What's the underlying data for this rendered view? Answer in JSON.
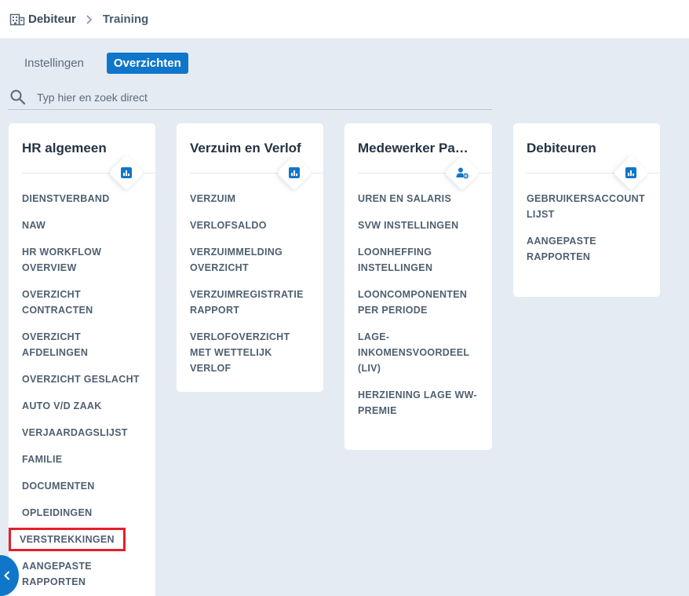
{
  "breadcrumb": {
    "icon": "building-icon",
    "items": [
      "Debiteur",
      "Training"
    ]
  },
  "tabs": [
    {
      "label": "Instellingen",
      "active": false
    },
    {
      "label": "Overzichten",
      "active": true
    }
  ],
  "search": {
    "placeholder": "Typ hier en zoek direct",
    "value": ""
  },
  "colors": {
    "accent": "#1076c9",
    "background": "#e5ebf3",
    "highlight": "#e3202a"
  },
  "cards": [
    {
      "title": "HR algemeen",
      "icon": "bar-chart-icon",
      "links": [
        "DIENSTVERBAND",
        "NAW",
        "HR WORKFLOW OVERVIEW",
        "OVERZICHT CONTRACTEN",
        "OVERZICHT AFDELINGEN",
        "OVERZICHT GESLACHT",
        "AUTO V/D ZAAK",
        "VERJAARDAGSLIJST",
        "FAMILIE",
        "DOCUMENTEN",
        "OPLEIDINGEN",
        "VERSTREKKINGEN",
        "AANGEPASTE RAPPORTEN"
      ],
      "highlighted_link": "VERSTREKKINGEN"
    },
    {
      "title": "Verzuim en Verlof",
      "icon": "bar-chart-icon",
      "links": [
        "VERZUIM",
        "VERLOFSALDO",
        "VERZUIMMELDING OVERZICHT",
        "VERZUIMREGISTRATIE RAPPORT",
        "VERLOFOVERZICHT MET WETTELIJK VERLOF"
      ]
    },
    {
      "title": "Medewerker Pa…",
      "icon": "user-settings-icon",
      "links": [
        "UREN EN SALARIS",
        "SVW INSTELLINGEN",
        "LOONHEFFING INSTELLINGEN",
        "LOONCOMPONENTEN PER PERIODE",
        "LAGE-INKOMENSVOORDEEL (LIV)",
        "HERZIENING LAGE WW-PREMIE"
      ]
    },
    {
      "title": "Debiteuren",
      "icon": "bar-chart-icon",
      "links": [
        "GEBRUIKERSACCOUNT LIJST",
        "AANGEPASTE RAPPORTEN"
      ]
    }
  ],
  "sidebar_toggle": {
    "icon": "chevron-left-icon"
  }
}
